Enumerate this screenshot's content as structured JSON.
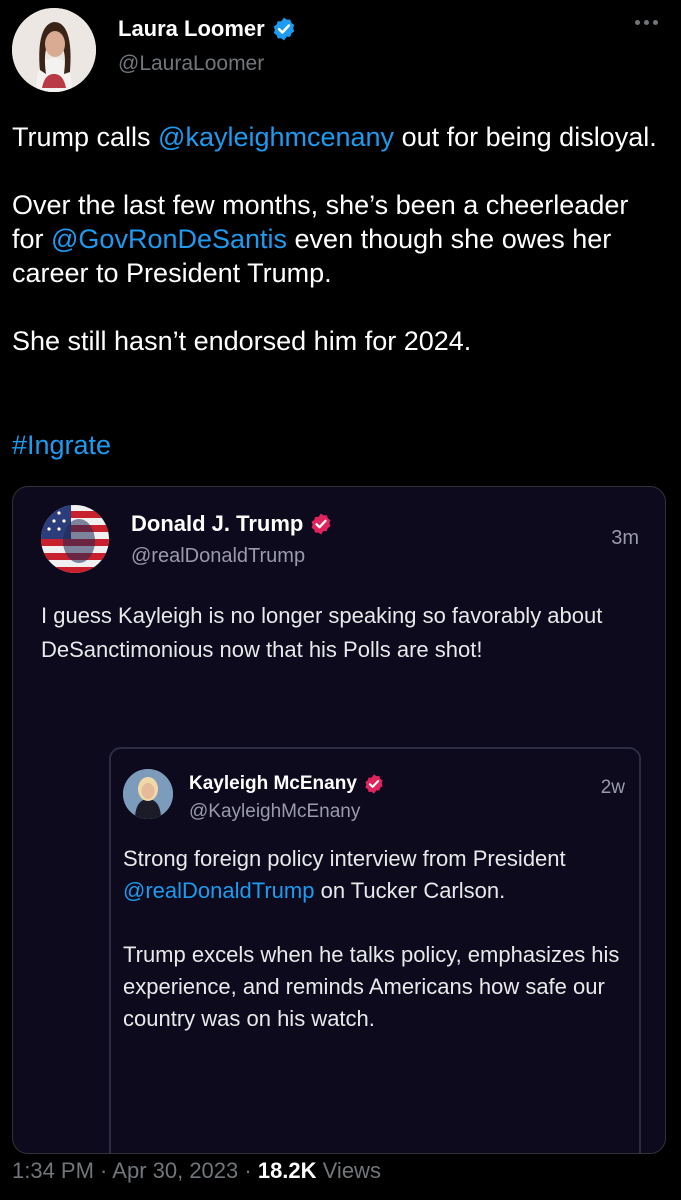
{
  "author": {
    "name": "Laura Loomer",
    "handle": "@LauraLoomer",
    "verified_color": "#1d9bf0"
  },
  "tweet": {
    "line1_pre": "Trump calls ",
    "mention1": "@kayleighmcenany",
    "line1_post": " out for being disloyal.",
    "para2_pre": "Over the last few months, she’s been a cheerleader for ",
    "mention2": "@GovRonDeSantis",
    "para2_post": " even though she owes her career to President Trump.",
    "para3": "She still hasn’t endorsed him for 2024.",
    "hashtag": "#Ingrate"
  },
  "quoted": {
    "name": "Donald J. Trump",
    "handle": "@realDonaldTrump",
    "time": "3m",
    "text": "I guess Kayleigh is no longer speaking so favorably about DeSanctimonious now that his Polls are shot!",
    "badge_color": "#e0245e"
  },
  "nested": {
    "name": "Kayleigh McEnany",
    "handle": "@KayleighMcEnany",
    "time": "2w",
    "text_pre": "Strong foreign policy interview from President ",
    "mention": "@realDonaldTrump",
    "text_post": " on Tucker Carlson.",
    "para2": "Trump excels when he talks policy, emphasizes his experience, and reminds Americans how safe our country was on his watch."
  },
  "meta": {
    "time": "1:34 PM",
    "sep1": " · ",
    "date": "Apr 30, 2023",
    "sep2": " · ",
    "views_count": "18.2K",
    "views_label": " Views"
  }
}
